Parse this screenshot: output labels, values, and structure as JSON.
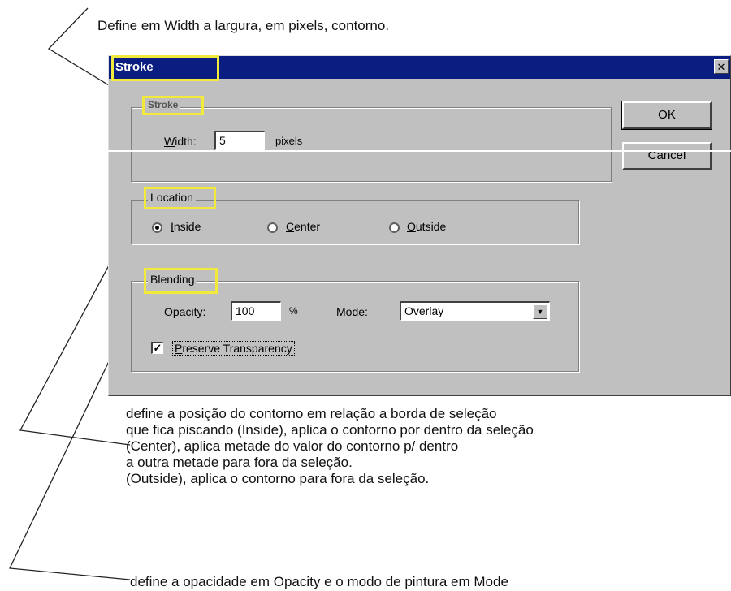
{
  "annotations": {
    "top": "Define em Width a largura, em pixels, contorno.",
    "location": "define a posição do contorno em relação a borda de seleção\nque fica piscando (Inside), aplica o contorno por dentro da seleção\n(Center), aplica metade do valor do contorno p/ dentro\na outra metade para fora da seleção.\n(Outside), aplica o contorno para fora da seleção.",
    "blending": "define a opacidade em Opacity e o modo de pintura em Mode"
  },
  "dialog": {
    "title": "Stroke",
    "close_glyph": "✕",
    "ok_label": "OK",
    "cancel_label": "Cancel",
    "stroke": {
      "legend": "Stroke",
      "width_label_u": "W",
      "width_label_rest": "idth:",
      "width_value": "5",
      "unit": "pixels"
    },
    "location": {
      "legend": "Location",
      "options": [
        {
          "label_u": "I",
          "label_rest": "nside",
          "checked": true
        },
        {
          "label_u": "C",
          "label_rest": "enter",
          "checked": false
        },
        {
          "label_u": "O",
          "label_rest": "utside",
          "checked": false
        }
      ]
    },
    "blending": {
      "legend": "Blending",
      "opacity_label_u": "O",
      "opacity_label_rest": "pacity:",
      "opacity_value": "100",
      "opacity_unit": "%",
      "mode_label_u": "M",
      "mode_label_rest": "ode:",
      "mode_value": "Overlay",
      "preserve_u": "P",
      "preserve_rest": "reserve Transparency",
      "preserve_checked_glyph": "✓"
    }
  },
  "colors": {
    "titlebar": "#0a1d80",
    "dialog_face": "#c0c0c0",
    "highlight_box": "#f2ea3a"
  }
}
